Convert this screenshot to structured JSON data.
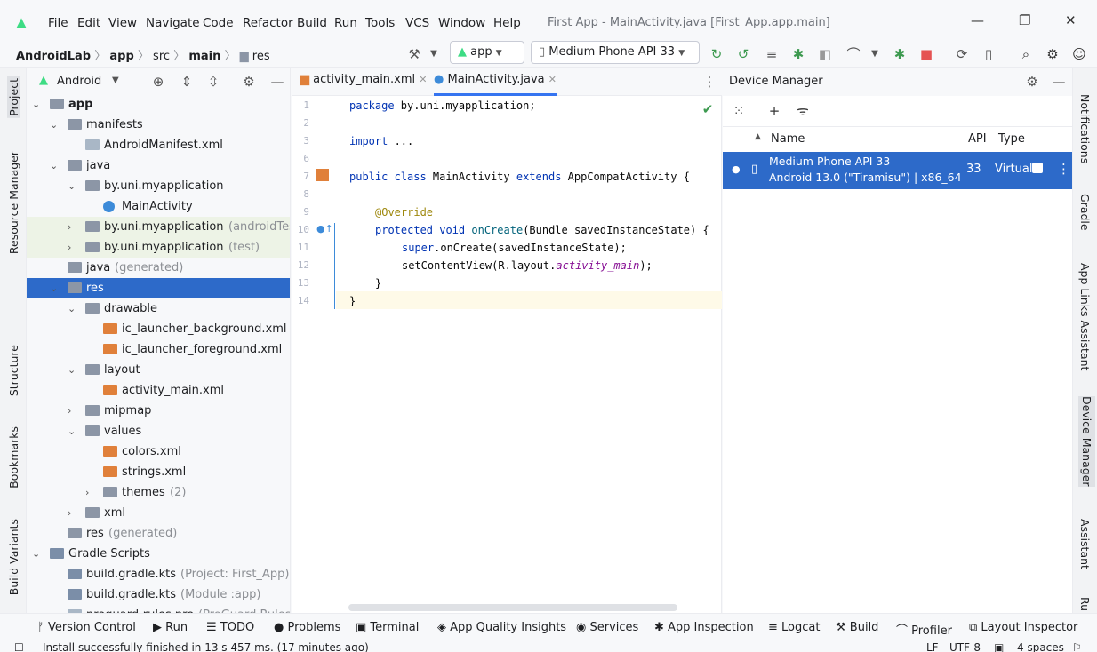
{
  "menu": {
    "items": [
      "File",
      "Edit",
      "View",
      "Navigate",
      "Code",
      "Refactor",
      "Build",
      "Run",
      "Tools",
      "VCS",
      "Window",
      "Help"
    ],
    "title": "First App - MainActivity.java [First_App.app.main]"
  },
  "nav": {
    "project": "AndroidLab",
    "module": "app",
    "src": "src",
    "main": "main",
    "res": "res",
    "run_config": "app",
    "device": "Medium Phone API 33"
  },
  "left_tabs": [
    "Project",
    "Resource Manager",
    "Structure",
    "Bookmarks",
    "Build Variants"
  ],
  "right_tabs": [
    "Notifications",
    "Gradle",
    "App Links Assistant",
    "Device Manager",
    "Assistant",
    "Ru"
  ],
  "project": {
    "view": "Android",
    "tree": [
      {
        "label": "app",
        "sub": "",
        "type": "folder",
        "bold": true
      },
      {
        "label": "manifests",
        "sub": "",
        "type": "folder"
      },
      {
        "label": "AndroidManifest.xml",
        "sub": "",
        "type": "file"
      },
      {
        "label": "java",
        "sub": "",
        "type": "folder"
      },
      {
        "label": "by.uni.myapplication",
        "sub": "",
        "type": "folder"
      },
      {
        "label": "MainActivity",
        "sub": "",
        "type": "class"
      },
      {
        "label": "by.uni.myapplication",
        "sub": "(androidTest)",
        "type": "folder"
      },
      {
        "label": "by.uni.myapplication",
        "sub": "(test)",
        "type": "folder"
      },
      {
        "label": "java",
        "sub": "(generated)",
        "type": "folder"
      },
      {
        "label": "res",
        "sub": "",
        "type": "folder"
      },
      {
        "label": "drawable",
        "sub": "",
        "type": "folder"
      },
      {
        "label": "ic_launcher_background.xml",
        "sub": "",
        "type": "xml"
      },
      {
        "label": "ic_launcher_foreground.xml",
        "sub": "",
        "type": "xml"
      },
      {
        "label": "layout",
        "sub": "",
        "type": "folder"
      },
      {
        "label": "activity_main.xml",
        "sub": "",
        "type": "xml"
      },
      {
        "label": "mipmap",
        "sub": "",
        "type": "folder"
      },
      {
        "label": "values",
        "sub": "",
        "type": "folder"
      },
      {
        "label": "colors.xml",
        "sub": "",
        "type": "xml"
      },
      {
        "label": "strings.xml",
        "sub": "",
        "type": "xml"
      },
      {
        "label": "themes",
        "sub": "(2)",
        "type": "folder"
      },
      {
        "label": "xml",
        "sub": "",
        "type": "folder"
      },
      {
        "label": "res",
        "sub": "(generated)",
        "type": "folder"
      },
      {
        "label": "Gradle Scripts",
        "sub": "",
        "type": "gradle"
      },
      {
        "label": "build.gradle.kts",
        "sub": "(Project: First_App)",
        "type": "gradle"
      },
      {
        "label": "build.gradle.kts",
        "sub": "(Module :app)",
        "type": "gradle"
      },
      {
        "label": "proguard-rules.pro",
        "sub": "(ProGuard Rules for \"",
        "type": "file"
      }
    ]
  },
  "editor": {
    "tabs": [
      "activity_main.xml",
      "MainActivity.java"
    ],
    "line_numbers": [
      "1",
      "2",
      "3",
      "6",
      "7",
      "8",
      "9",
      "10",
      "11",
      "12",
      "13",
      "14"
    ],
    "code": {
      "pkg_kw": "package",
      "pkg": " by.uni.myapplication;",
      "imp_kw": "import",
      "imp": " ...",
      "cls1": "public class",
      "cls2": " MainActivity ",
      "cls3": "extends",
      "cls4": " AppCompatActivity {",
      "ann": "@Override",
      "m1": "protected void",
      "m2": " onCreate",
      "m3": "(Bundle savedInstanceState) {",
      "s1": "super",
      "s2": ".onCreate(savedInstanceState);",
      "c1": "setContentView(R.layout.",
      "c2": "activity_main",
      "c3": ");",
      "close1": "}",
      "close2": "}"
    }
  },
  "device_manager": {
    "title": "Device Manager",
    "columns": [
      "Name",
      "API",
      "Type"
    ],
    "device": {
      "name": "Medium Phone API 33",
      "detail": "Android 13.0 (\"Tiramisu\") | x86_64",
      "api": "33",
      "type": "Virtual"
    }
  },
  "bottom_tools": [
    "Version Control",
    "Run",
    "TODO",
    "Problems",
    "Terminal",
    "App Quality Insights",
    "Services",
    "App Inspection",
    "Logcat",
    "Build",
    "Profiler",
    "Layout Inspector"
  ],
  "status": {
    "message": "Install successfully finished in 13 s 457 ms. (17 minutes ago)",
    "line_sep": "LF",
    "encoding": "UTF-8",
    "indent": "4 spaces"
  }
}
